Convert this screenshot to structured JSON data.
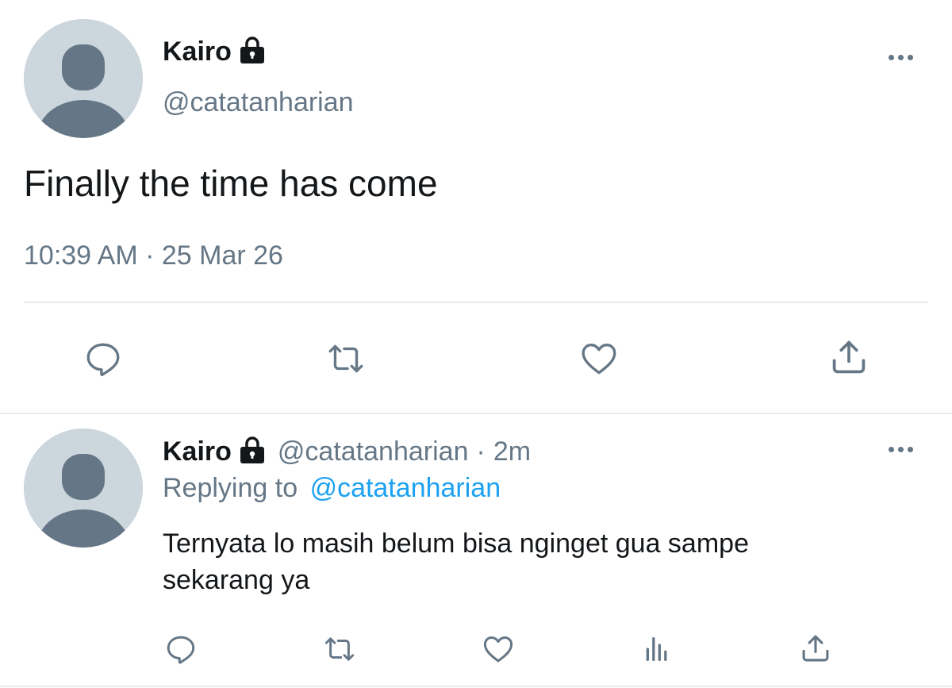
{
  "main_tweet": {
    "display_name": "Kairo",
    "handle": "@catatanharian",
    "text": "Finally the time has come",
    "timestamp": "10:39 AM · 25 Mar 26",
    "protected": true
  },
  "reply": {
    "display_name": "Kairo",
    "handle": "@catatanharian",
    "separator": "·",
    "age": "2m",
    "replying_prefix": "Replying to",
    "replying_to": "@catatanharian",
    "text_line1": "Ternyata lo masih belum bisa nginget gua sampe",
    "text_line2": "sekarang ya",
    "protected": true
  },
  "colors": {
    "text": "#14171a",
    "secondary": "#657786",
    "link": "#1da1f2",
    "divider": "#e6ecf0",
    "avatar_bg": "#ccd6dd",
    "avatar_fg": "#657786"
  },
  "icons": {
    "main_actions": [
      "reply-icon",
      "retweet-icon",
      "like-icon",
      "share-icon"
    ],
    "reply_actions": [
      "reply-icon",
      "retweet-icon",
      "like-icon",
      "analytics-icon",
      "share-icon"
    ]
  }
}
